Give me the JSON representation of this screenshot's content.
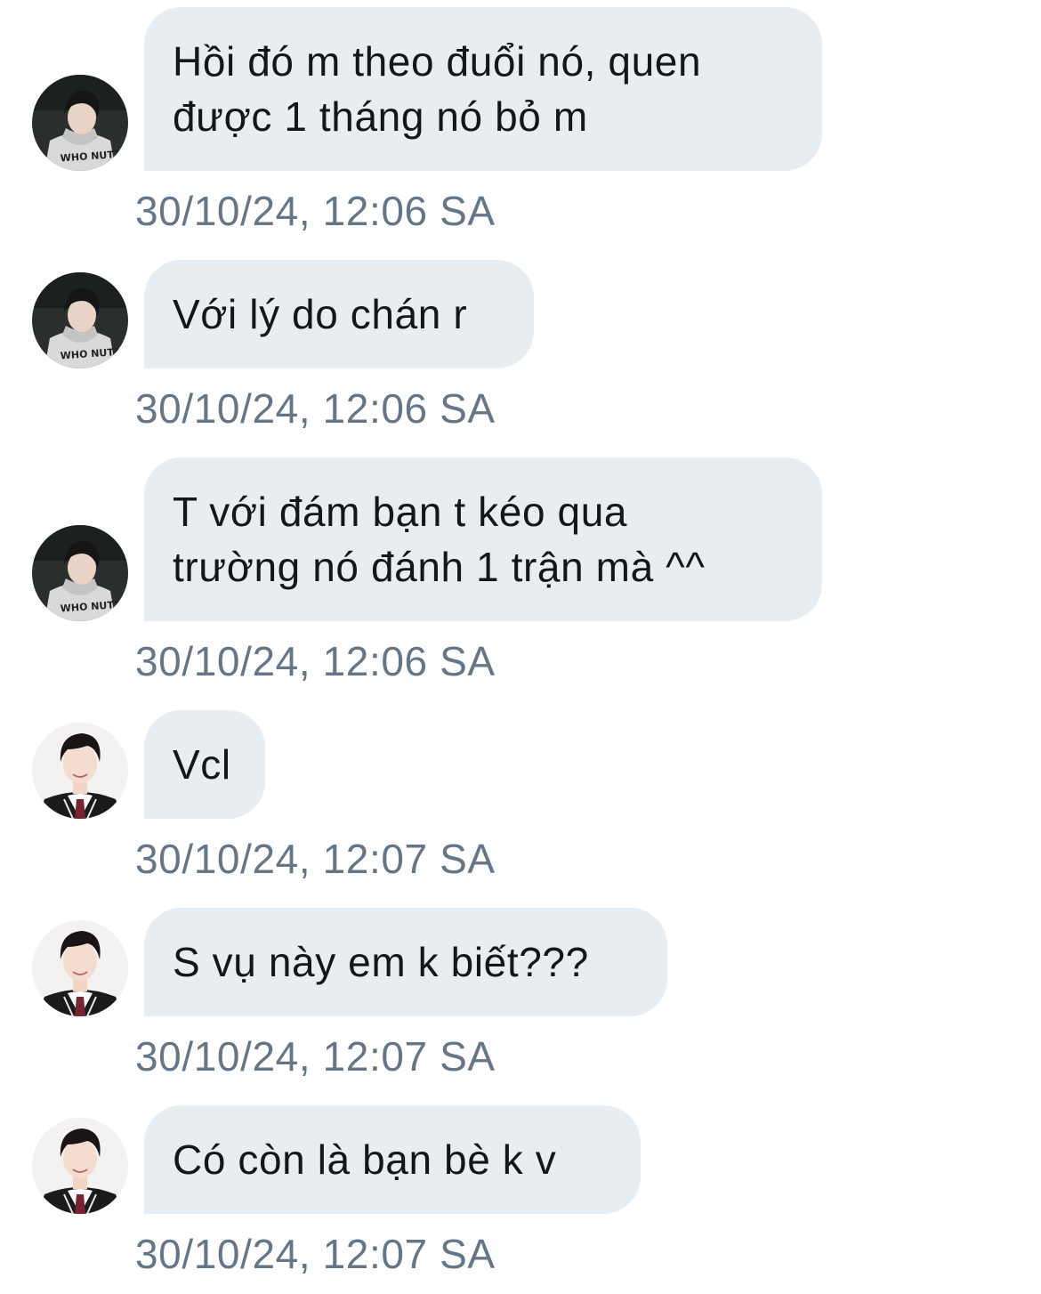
{
  "conversation": {
    "messages": [
      {
        "sender": "hoodie",
        "text": "Hồi đó m theo đuổi nó, quen\nđược 1 tháng nó bỏ m",
        "time": "30/10/24, 12:06 SA"
      },
      {
        "sender": "hoodie",
        "text": "Với lý do chán r",
        "time": "30/10/24, 12:06 SA"
      },
      {
        "sender": "hoodie",
        "text": "T với đám bạn t kéo qua\ntrường nó đánh 1 trận mà ^^",
        "time": "30/10/24, 12:06 SA"
      },
      {
        "sender": "uniform",
        "text": "Vcl",
        "time": "30/10/24, 12:07 SA"
      },
      {
        "sender": "uniform",
        "text": "S vụ này em k biết???",
        "time": "30/10/24, 12:07 SA"
      },
      {
        "sender": "uniform",
        "text": "Có còn là bạn bè k v",
        "time": "30/10/24, 12:07 SA"
      }
    ],
    "avatar_hoodie_print": "WHO NUT?!",
    "colors": {
      "bubble": "#e8edf2",
      "text": "#14171a",
      "timestamp": "#657786"
    }
  }
}
